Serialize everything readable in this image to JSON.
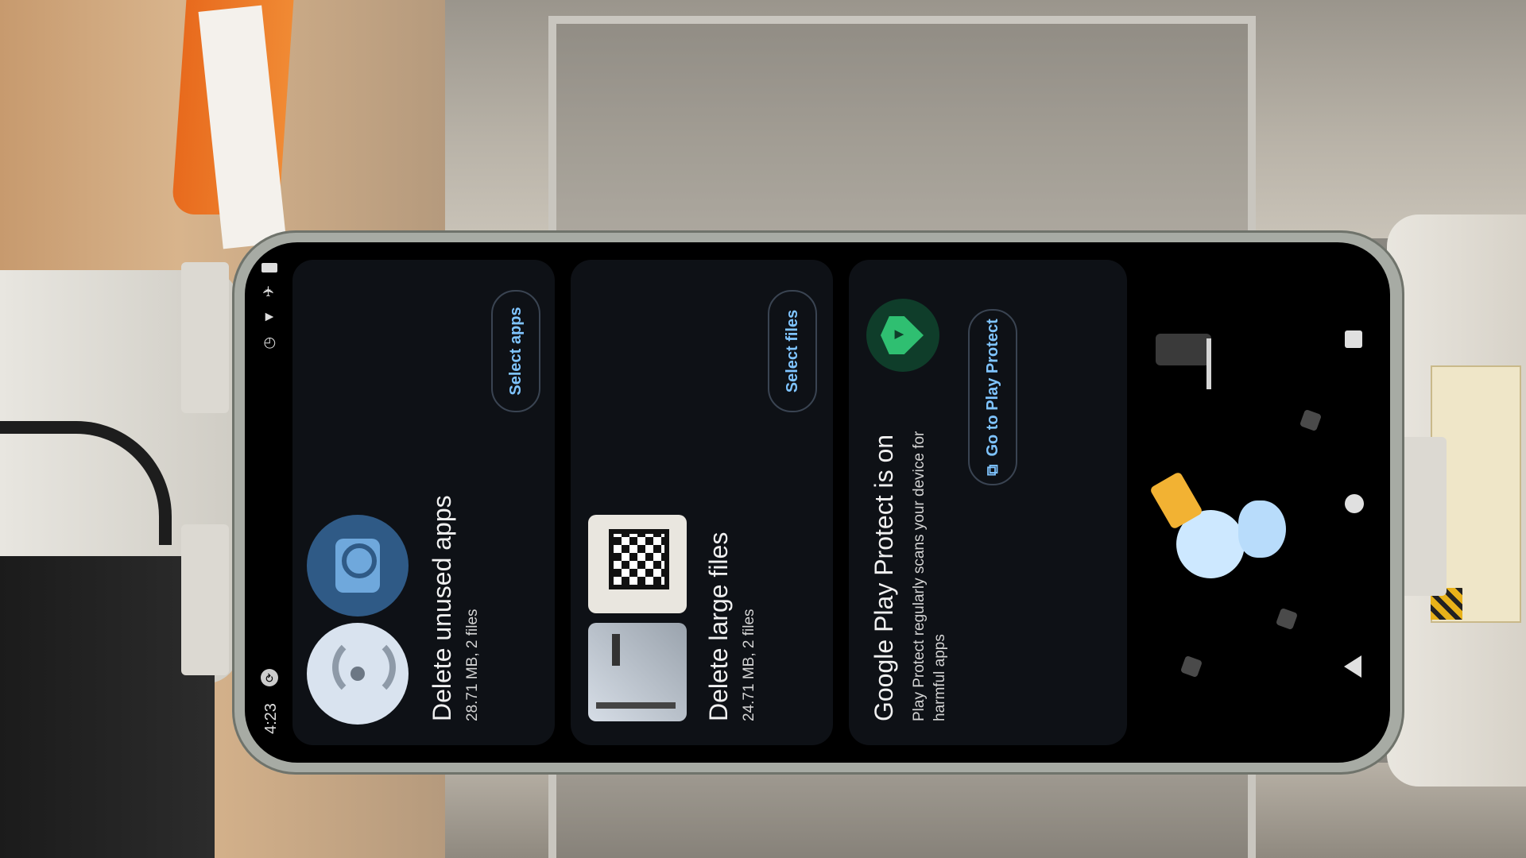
{
  "status_bar": {
    "time": "4:23",
    "icons": [
      "sync-icon",
      "alarm-icon",
      "wifi-icon",
      "airplane-icon",
      "battery-icon"
    ]
  },
  "cards": {
    "unused_apps": {
      "title": "Delete unused apps",
      "subtitle": "28.71 MB, 2 files",
      "button": "Select apps"
    },
    "large_files": {
      "title": "Delete large files",
      "subtitle": "24.71 MB, 2 files",
      "button": "Select files"
    },
    "play_protect": {
      "title": "Google Play Protect is on",
      "subtitle": "Play Protect regularly scans your device for harmful apps",
      "button": "Go to Play Protect"
    }
  },
  "nav": {
    "icons": [
      "back-icon",
      "home-icon",
      "recents-icon"
    ]
  },
  "colors": {
    "accent": "#7fc4ff",
    "card_bg": "#0e1116",
    "play_protect_green": "#2fbf71"
  }
}
